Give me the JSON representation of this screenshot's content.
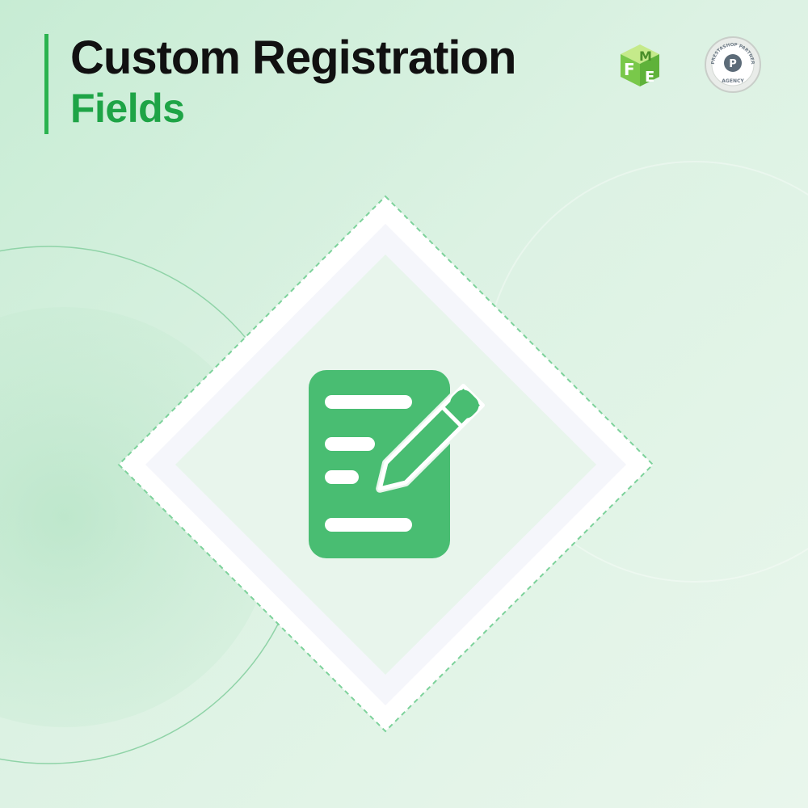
{
  "header": {
    "title_line1": "Custom Registration",
    "title_line2": "Fields"
  },
  "logos": {
    "fme_letters": [
      "F",
      "M",
      "E"
    ],
    "partner_arc_text": "PRESTASHOP PARTNER",
    "partner_bottom_text": "AGENCY",
    "partner_monogram": "P"
  },
  "main_icon": "document-with-pencil-icon",
  "colors": {
    "accent_green": "#1ea446",
    "icon_green": "#49bd72",
    "title_dark": "#111111",
    "bar_accent": "#2ab34f"
  }
}
